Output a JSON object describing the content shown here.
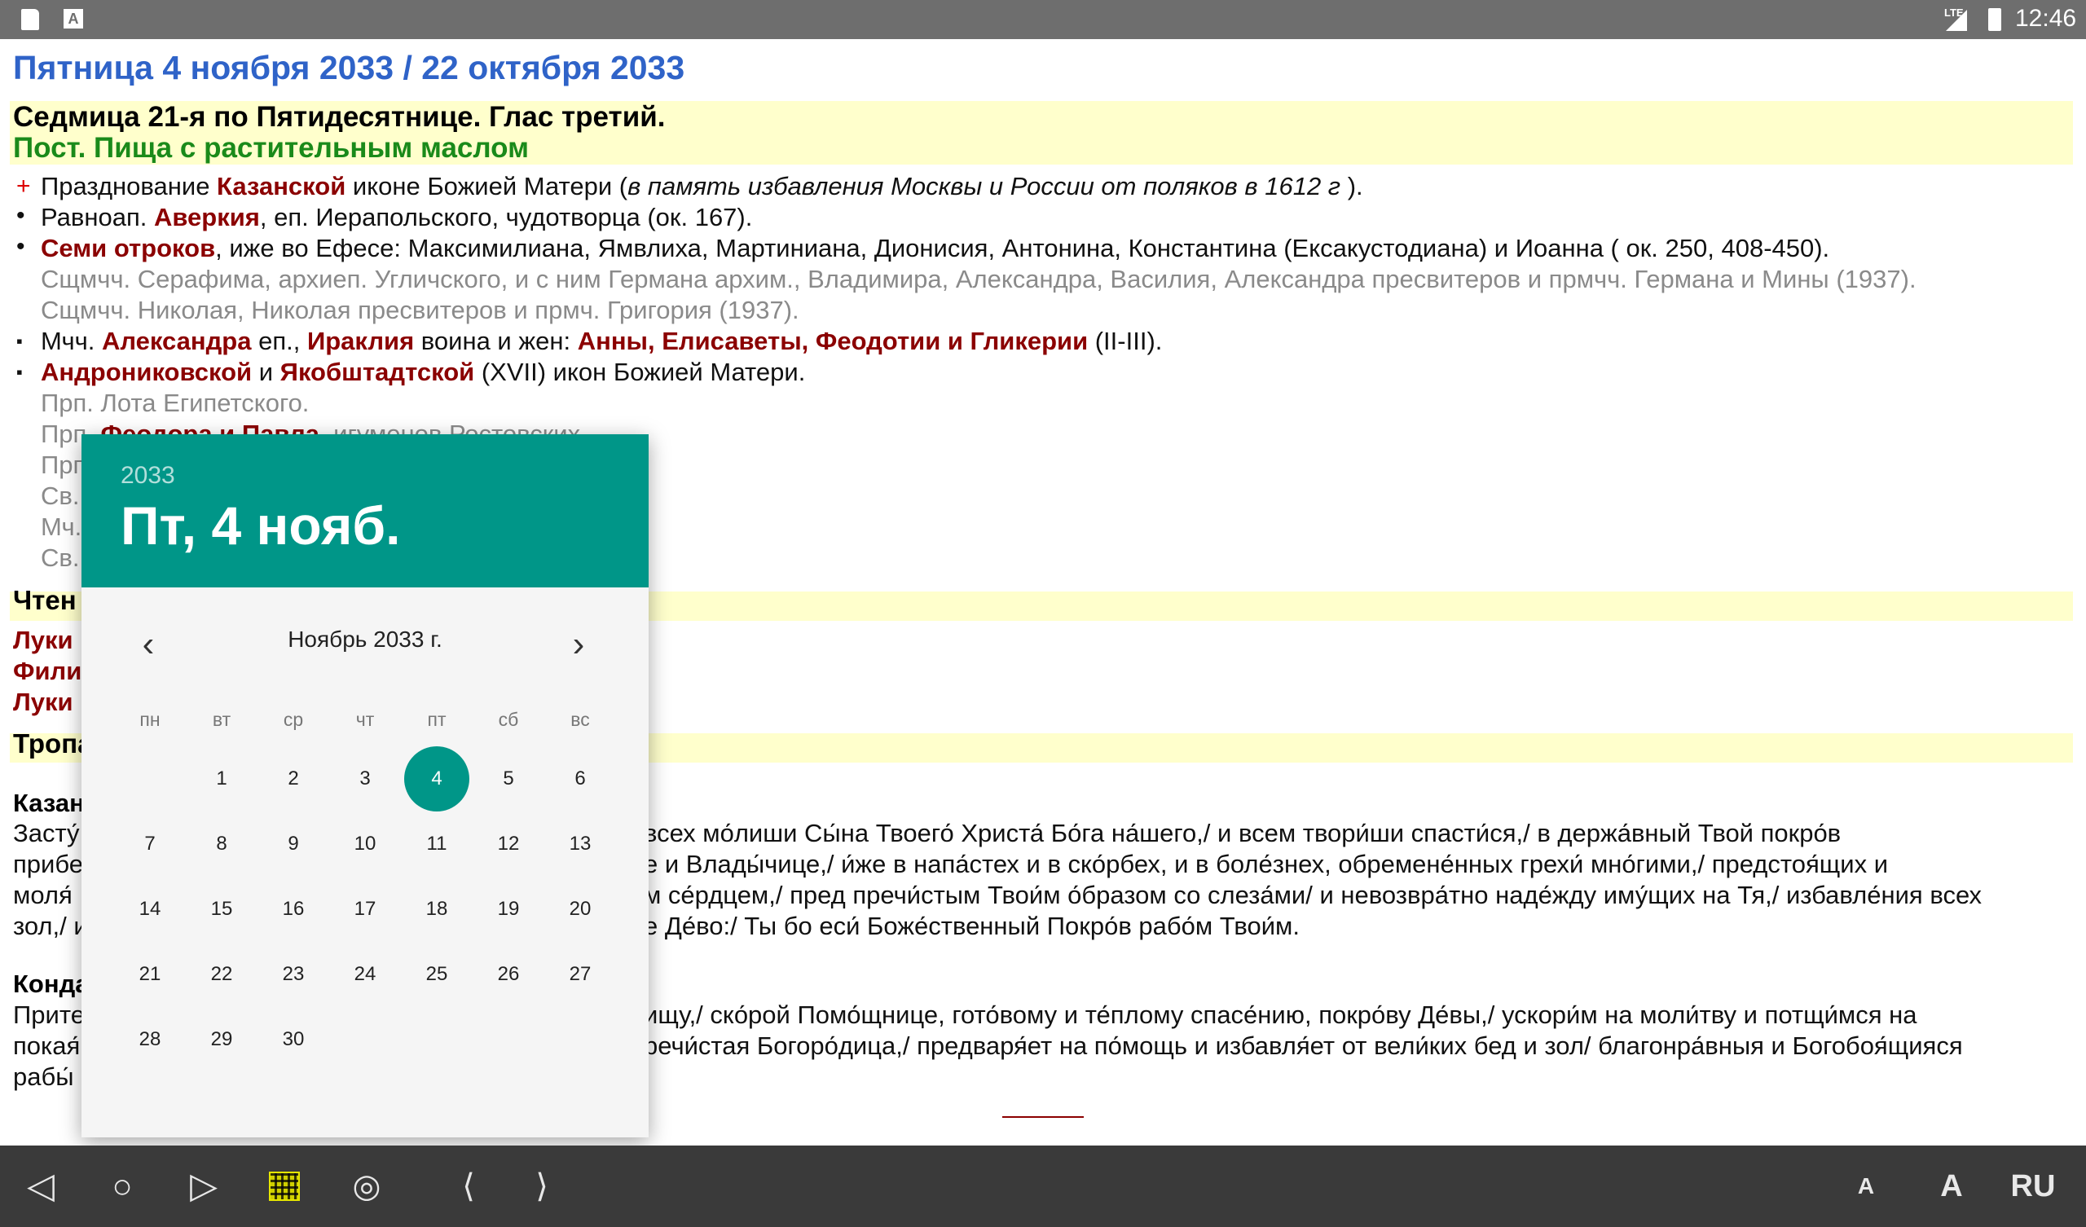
{
  "status_bar": {
    "lte": "LTE",
    "time": "12:46"
  },
  "page": {
    "title": "Пятница 4 ноября 2033 / 22 октября 2033",
    "week": "Седмица 21-я по Пятидесятнице. Глас третий.",
    "fast": "Пост. Пища с растительным маслом"
  },
  "saints": [
    {
      "a": "Празднование ",
      "b": "Казанской",
      "c": " иконе Божией Матери (",
      "d": "в память избавления Москвы и России от поляков в 1612 г",
      "e": " )."
    },
    {
      "a": "Равноап. ",
      "b": "Аверкия",
      "c": ", еп. Иерапольского, чудотворца (ок. 167)."
    },
    {
      "b": "Семи отроков",
      "c": ", иже во Ефесе: Максимилиана, Ямвлиха, Мартиниана, Дионисия, Антонина, Константина (Ексакустодиана) и Иоанна ( ок. 250, 408-450)."
    },
    {
      "a": "Сщмчч. Серафима, архиеп. Угличского, и с ним Германа архим., Владимира, Александра, Василия, Александра пресвитеров и прмчч. Германа и Мины (1937)."
    },
    {
      "a": "Сщмчч. Николая, Николая пресвитеров и прмч. Григория (1937)."
    },
    {
      "a": "Мчч. ",
      "b": "Александра",
      "c": " еп., ",
      "d": "Ираклия",
      "e": " воина и жен: ",
      "f": "Анны, Елисаветы, Феодотии и Гликерии",
      "g": " (II-III)."
    },
    {
      "b": "Андрониковской",
      "c": " и ",
      "d": "Якобштадтской",
      "e": " (XVII) икон Божией Матери."
    },
    {
      "a": "Прп. Лота Египетского."
    },
    {
      "a": "Прп. ",
      "b": "Феодора и Павла",
      "c": ", игуменов Ростовских."
    },
    {
      "a": "Прп."
    },
    {
      "a": "Св."
    },
    {
      "a": "Мч."
    },
    {
      "a": "Св."
    }
  ],
  "readings": {
    "heading": "Чтен",
    "items": [
      "Луки",
      "Фили",
      "Луки"
    ]
  },
  "troparia": {
    "heading": "Тропа",
    "tropar_title": "Казан",
    "tropar_lines_left": [
      "Засту́",
      "прибе",
      "моля́",
      "зол,/ и"
    ],
    "tropar_lines_right": [
      "всех мо́лиши Сы́на Твоего́ Христа́ Бо́га на́шего,/ и всем твори́ши спасти́ся,/ в держа́вный Твой покро́в",
      "е и Влады́чице,/ и́же в напа́стех и в ско́рбех, и в боле́знех, обремене́нных грехи́ мно́гими,/ предстоя́щих и",
      "м се́рдцем,/ пред пречи́стым Твои́м о́бразом со слеза́ми/ и невозвра́тно наде́жду иму́щих на Тя,/ избавле́ния всех",
      "е Де́во:/ Ты бо еси́ Боже́ственный Покро́в рабо́м Твои́м."
    ],
    "kondak_title": "Конда",
    "kondak_lines_left": [
      "Прите",
      "покая́",
      "рабы́"
    ],
    "kondak_lines_right": [
      "ищу,/ ско́рой Помо́щнице, гото́вому и те́плому спасе́нию, покро́ву Де́вы,/ ускори́м на моли́тву и потщи́мся на",
      "речи́стая Богоро́дица,/ предваря́ет на по́мощь и избавля́ет от вели́ких бед и зол/ благонра́вныя и Богобоя́щияся"
    ]
  },
  "date_picker": {
    "year": "2033",
    "selected_date": "Пт, 4 нояб.",
    "month_label": "Ноябрь 2033 г.",
    "prev_icon": "‹",
    "next_icon": "›",
    "weekdays": [
      "пн",
      "вт",
      "ср",
      "чт",
      "пт",
      "сб",
      "вс"
    ],
    "first_weekday_offset": 1,
    "days_in_month": 30,
    "selected_day": 4,
    "accent_color": "#009688"
  },
  "nav_bar": {
    "back": "◁",
    "home": "○",
    "forward": "▷",
    "calendar_icon": "calendar-grid-icon",
    "circle": "◎",
    "prev": "⟨",
    "next": "⟩",
    "font_small": "A",
    "font_large": "A",
    "lang": "RU"
  }
}
